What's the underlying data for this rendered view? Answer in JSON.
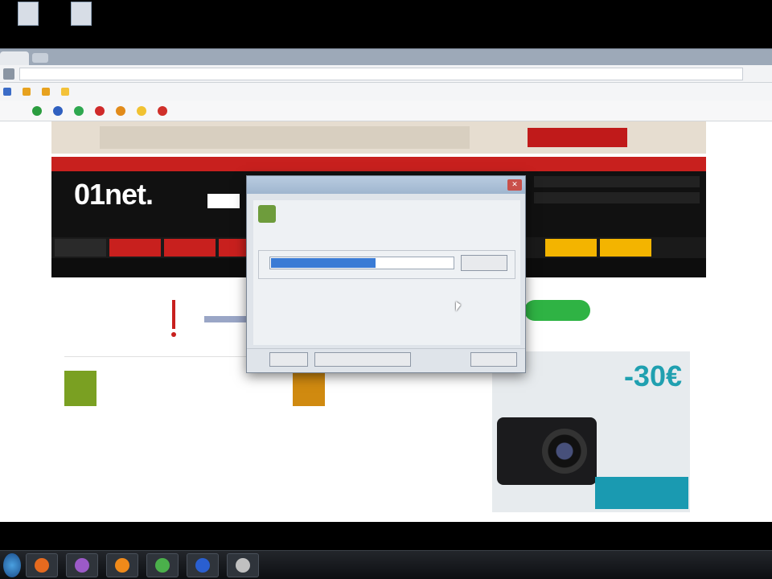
{
  "desktop": {
    "icons": [
      {
        "label": ""
      },
      {
        "label": ""
      }
    ]
  },
  "browser": {
    "address": "",
    "bookmarks": [
      {
        "label": "",
        "color": "#3b6cc7"
      },
      {
        "label": "",
        "color": "#e7a21f"
      },
      {
        "label": "",
        "color": "#e7a21f"
      },
      {
        "label": "",
        "color": "#f3c23a"
      }
    ],
    "toolbar": [
      {
        "label": "",
        "color": "#2b9d3f"
      },
      {
        "label": "",
        "color": "#3060c0"
      },
      {
        "label": "",
        "color": "#2fa850"
      },
      {
        "label": "",
        "color": "#d02a2a"
      },
      {
        "label": "",
        "color": "#e28b1a"
      },
      {
        "label": "",
        "color": "#f1c232"
      },
      {
        "label": "",
        "color": "#d0302a"
      }
    ]
  },
  "site": {
    "banner_slogan": "",
    "banner_cta": "",
    "logo": "01net.",
    "logo_tagline": "",
    "nav": [
      "",
      "",
      "",
      "",
      "",
      "",
      "",
      "",
      ""
    ],
    "categories": [
      {
        "label": "",
        "style": "dark"
      },
      {
        "label": "",
        "style": "red"
      },
      {
        "label": "",
        "style": "red"
      },
      {
        "label": "",
        "style": "red"
      },
      {
        "label": "",
        "style": "red"
      },
      {
        "label": "",
        "style": "yellow"
      },
      {
        "label": "",
        "style": "yellow"
      }
    ],
    "subnav": [
      "",
      "",
      "",
      "",
      "",
      "",
      "",
      ""
    ],
    "notice_title": "",
    "section_title": "",
    "items": [
      {
        "category": "",
        "title": "",
        "desc": "",
        "color": "#7aa022"
      },
      {
        "category": "",
        "title": "",
        "desc": "",
        "color": "#d08a10"
      }
    ],
    "ad": {
      "text": "",
      "price": "-30€",
      "cta": "",
      "model": ""
    }
  },
  "dialog": {
    "title": "",
    "message": "",
    "group_label": "",
    "path_value": "",
    "browse_label": "",
    "space_required": "",
    "space_available": "",
    "back_label": "",
    "next_label": "",
    "cancel_label": ""
  },
  "taskbar": {
    "clock": "",
    "apps": [
      {
        "name": "firefox-task",
        "color": "#e56a1f"
      },
      {
        "name": "winamp-task",
        "color": "#9c5ac8"
      },
      {
        "name": "orange-task",
        "color": "#f08a1a"
      },
      {
        "name": "green-task",
        "color": "#4bb04b"
      },
      {
        "name": "word-task",
        "color": "#2a5fd0"
      },
      {
        "name": "tool-task",
        "color": "#c0c0c0"
      }
    ]
  }
}
